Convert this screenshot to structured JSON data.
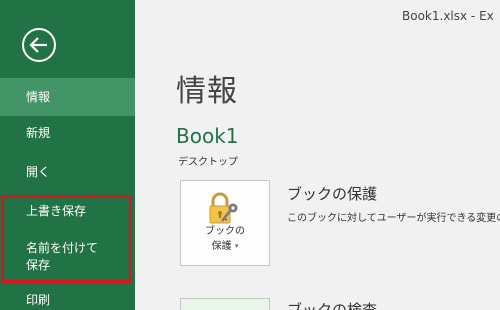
{
  "window": {
    "title": "Book1.xlsx  -  Ex"
  },
  "sidebar": {
    "items": [
      {
        "label": "情報"
      },
      {
        "label": "新規"
      },
      {
        "label": "開く"
      },
      {
        "label": "上書き保存"
      },
      {
        "label": "名前を付けて保存"
      },
      {
        "label": "印刷"
      }
    ]
  },
  "main": {
    "page_title": "情報",
    "book_name": "Book1",
    "book_path": "デスクトップ",
    "protect": {
      "button_label_line1": "ブックの",
      "button_label_line2": "保護",
      "caret": "▾",
      "title": "ブックの保護",
      "description": "このブックに対してユーザーが実行できる変更の種類を"
    },
    "inspect": {
      "title": "ブックの検査"
    }
  },
  "colors": {
    "brand": "#217346",
    "selected": "#439467",
    "highlight": "#e0121b"
  },
  "icons": {
    "back": "back-arrow-icon",
    "protect": "lock-key-icon"
  }
}
